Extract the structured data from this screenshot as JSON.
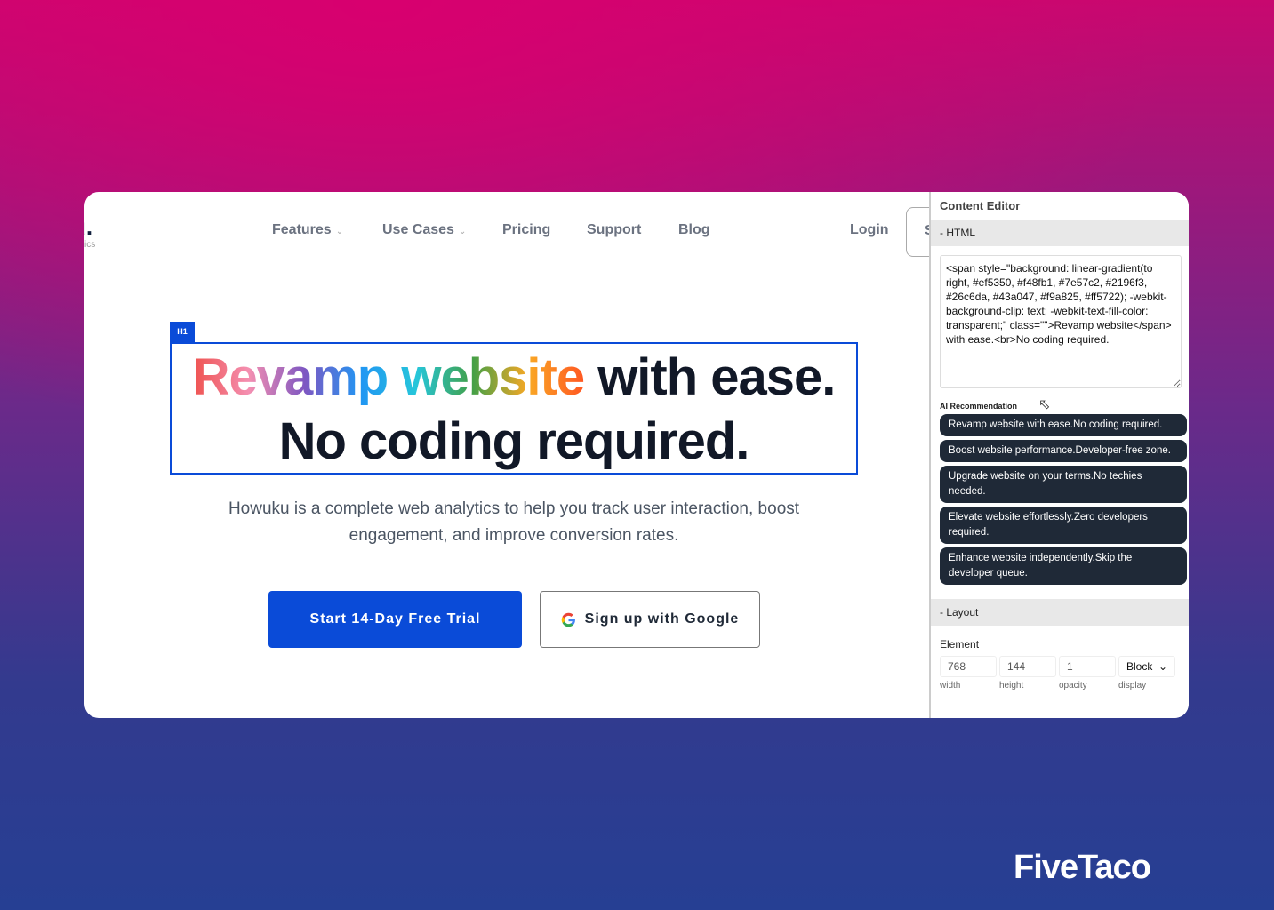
{
  "site": {
    "logo": "u.",
    "logo_sub": "ics",
    "nav": [
      {
        "label": "Features",
        "dropdown": true
      },
      {
        "label": "Use Cases",
        "dropdown": true
      },
      {
        "label": "Pricing"
      },
      {
        "label": "Support"
      },
      {
        "label": "Blog"
      }
    ],
    "login": "Login",
    "cut_button": "S",
    "h1_tag": "H1",
    "headline_gradient": "Revamp website",
    "headline_rest": " with ease.",
    "headline_line2": "No coding required.",
    "subtitle": "Howuku is a complete web analytics to help you track user interaction, boost engagement, and improve conversion rates.",
    "cta_primary": "Start 14-Day Free Trial",
    "cta_google": "Sign up with Google",
    "accent": "#0a4bd8"
  },
  "panel": {
    "title": "Content Editor",
    "html_section": "- HTML",
    "html_value": "<span style=\"background: linear-gradient(to right, #ef5350, #f48fb1, #7e57c2, #2196f3, #26c6da, #43a047, #f9a825, #ff5722); -webkit-background-clip: text; -webkit-text-fill-color: transparent;\" class=\"\">Revamp website</span> with ease.<br>No coding required.",
    "ai_label": "AI Recommendation",
    "recommendations": [
      "Revamp website with ease.No coding required.",
      "Boost website performance.Developer-free zone.",
      "Upgrade website on your terms.No techies needed.",
      "Elevate website effortlessly.Zero developers required.",
      "Enhance website independently.Skip the developer queue."
    ],
    "layout_section": "- Layout",
    "element_label": "Element",
    "fields": [
      {
        "value": "768",
        "label": "width"
      },
      {
        "value": "144",
        "label": "height"
      },
      {
        "value": "1",
        "label": "opacity"
      },
      {
        "value": "Block",
        "label": "display"
      }
    ]
  },
  "brand": "FiveTaco"
}
